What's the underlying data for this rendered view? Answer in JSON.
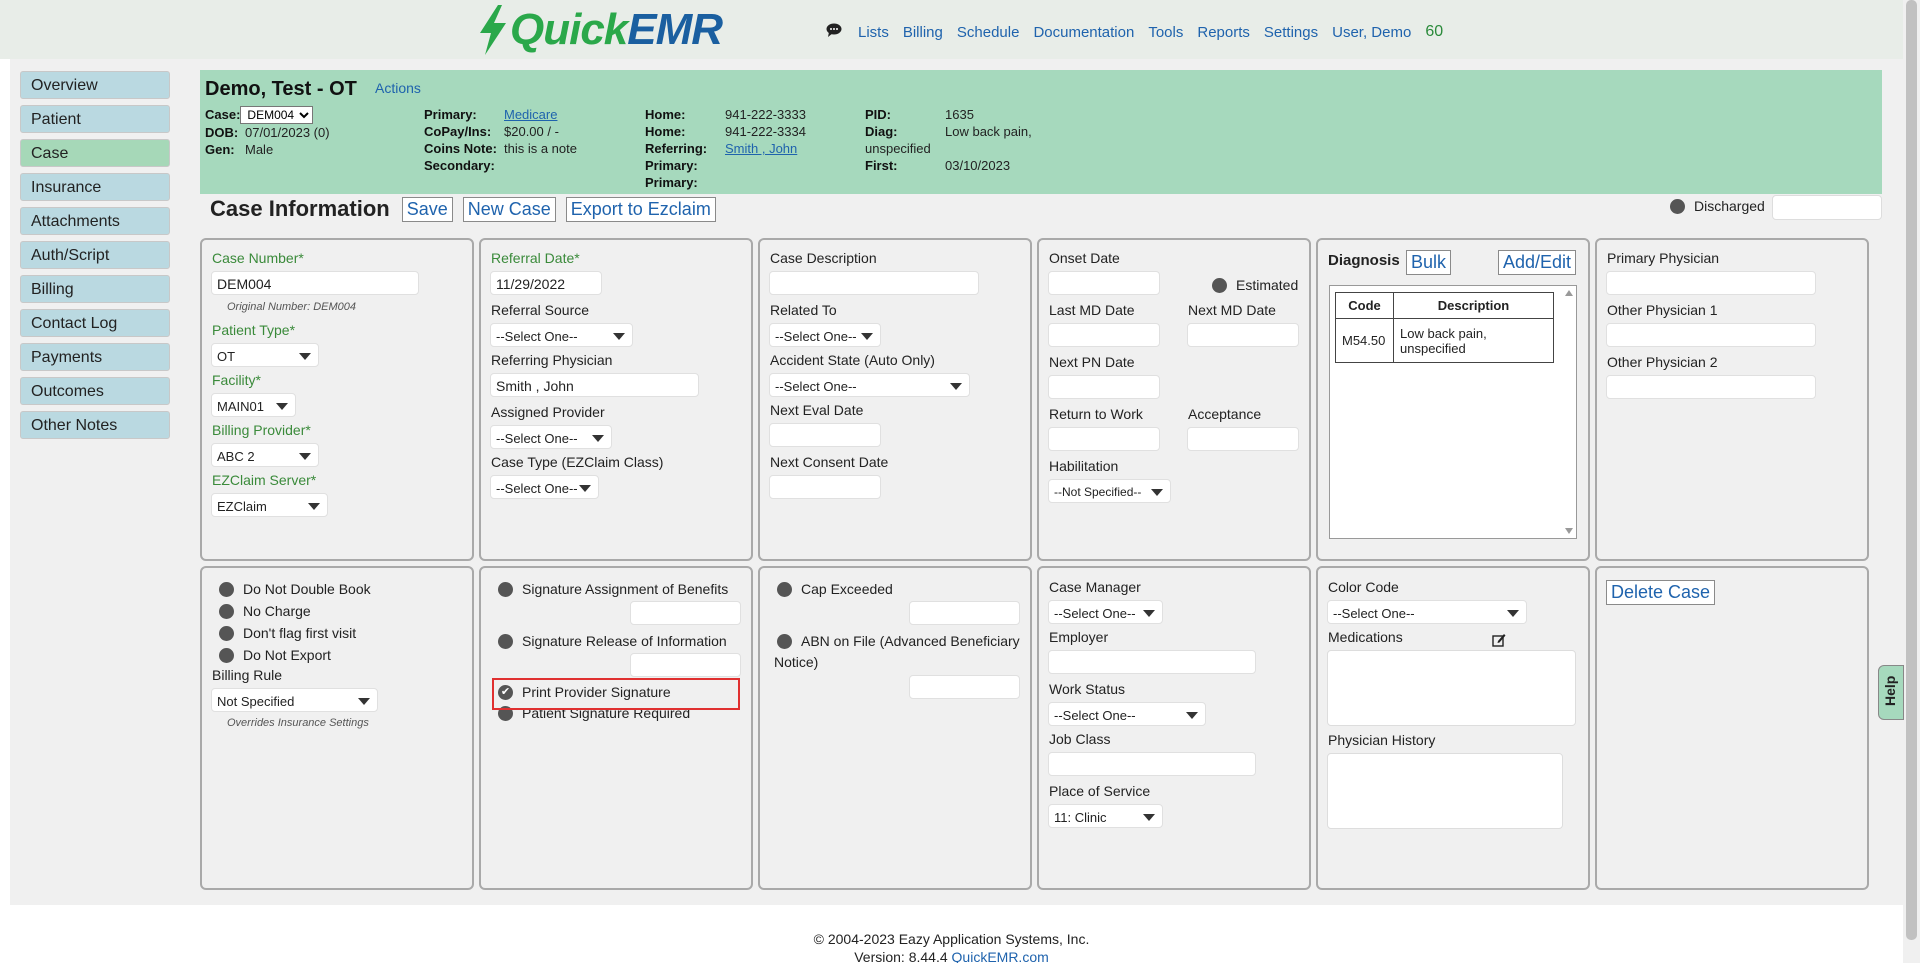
{
  "app": {
    "logo_quick": "Quick",
    "logo_emr": "EMR"
  },
  "topnav": {
    "items": [
      "Lists",
      "Billing",
      "Schedule",
      "Documentation",
      "Tools",
      "Reports",
      "Settings",
      "User, Demo"
    ],
    "count": "60"
  },
  "sidebar": {
    "items": [
      "Overview",
      "Patient",
      "Case",
      "Insurance",
      "Attachments",
      "Auth/Script",
      "Billing",
      "Contact Log",
      "Payments",
      "Outcomes",
      "Other Notes"
    ],
    "active": "Case"
  },
  "header": {
    "patient_name": "Demo, Test - OT",
    "actions_label": "Actions",
    "case_label": "Case:",
    "case_value": "DEM004",
    "dob_label": "DOB:",
    "dob_value": "07/01/2023 (0)",
    "gen_label": "Gen:",
    "gen_value": "Male",
    "primary_label": "Primary:",
    "primary_value": "Medicare",
    "copay_label": "CoPay/Ins:",
    "copay_value": "$20.00 / -",
    "coins_label": "Coins Note:",
    "coins_value": "this is a note",
    "secondary_label": "Secondary:",
    "home1_label": "Home:",
    "home1_value": "941-222-3333",
    "home2_label": "Home:",
    "home2_value": "941-222-3334",
    "referring_label": "Referring:",
    "referring_value": "Smith , John",
    "primary2_label": "Primary:",
    "primary3_label": "Primary:",
    "pid_label": "PID:",
    "pid_value": "1635",
    "diag_label": "Diag:",
    "diag_value_1": "Low back pain,",
    "diag_value_2": "unspecified",
    "first_label": "First:",
    "first_value": "03/10/2023"
  },
  "titlebar": {
    "title": "Case Information",
    "save": "Save",
    "new_case": "New Case",
    "export": "Export to Ezclaim",
    "discharged": "Discharged"
  },
  "panel1": {
    "case_number_label": "Case Number*",
    "case_number_value": "DEM004",
    "original_number": "Original Number: DEM004",
    "patient_type_label": "Patient Type*",
    "patient_type_value": "OT",
    "facility_label": "Facility*",
    "facility_value": "MAIN01",
    "billing_provider_label": "Billing Provider*",
    "billing_provider_value": "ABC 2",
    "ezclaim_server_label": "EZClaim Server*",
    "ezclaim_server_value": "EZClaim"
  },
  "panel2": {
    "referral_date_label": "Referral Date*",
    "referral_date_value": "11/29/2022",
    "referral_source_label": "Referral Source",
    "referral_source_value": "--Select One--",
    "referring_physician_label": "Referring Physician",
    "referring_physician_value": "Smith , John",
    "assigned_provider_label": "Assigned Provider",
    "assigned_provider_value": "--Select One--",
    "case_type_label": "Case Type (EZClaim Class)",
    "case_type_value": "--Select One--"
  },
  "panel3": {
    "case_description_label": "Case Description",
    "related_to_label": "Related To",
    "related_to_value": "--Select One--",
    "accident_state_label": "Accident State (Auto Only)",
    "accident_state_value": "--Select One--",
    "next_eval_label": "Next Eval Date",
    "next_consent_label": "Next Consent Date"
  },
  "panel4": {
    "onset_label": "Onset Date",
    "estimated_label": "Estimated",
    "last_md_label": "Last MD Date",
    "next_md_label": "Next MD Date",
    "next_pn_label": "Next PN Date",
    "return_work_label": "Return to Work",
    "acceptance_label": "Acceptance",
    "habilitation_label": "Habilitation",
    "habilitation_value": "--Not Specified--"
  },
  "panel5": {
    "diagnosis_label": "Diagnosis",
    "bulk": "Bulk",
    "add_edit": "Add/Edit",
    "col_code": "Code",
    "col_description": "Description",
    "rows": [
      {
        "code": "M54.50",
        "desc_1": "Low back pain,",
        "desc_2": "unspecified"
      }
    ]
  },
  "panel6": {
    "primary_physician_label": "Primary Physician",
    "other_physician_1_label": "Other Physician 1",
    "other_physician_2_label": "Other Physician 2"
  },
  "panel7": {
    "do_not_double_book": "Do Not Double Book",
    "no_charge": "No Charge",
    "dont_flag_first_visit": "Don't flag first visit",
    "do_not_export": "Do Not Export",
    "billing_rule_label": "Billing Rule",
    "billing_rule_value": "Not Specified",
    "overrides_note": "Overrides Insurance Settings"
  },
  "panel8": {
    "sig_assignment": "Signature Assignment of Benefits",
    "sig_release": "Signature Release of Information",
    "print_provider_sig": "Print Provider Signature",
    "patient_sig_required": "Patient Signature Required"
  },
  "panel9": {
    "cap_exceeded": "Cap Exceeded",
    "abn_on_file_1": "ABN on File (Advanced Beneficiary",
    "abn_on_file_2": "Notice)"
  },
  "panel10": {
    "case_manager_label": "Case Manager",
    "case_manager_value": "--Select One--",
    "employer_label": "Employer",
    "work_status_label": "Work Status",
    "work_status_value": "--Select One--",
    "job_class_label": "Job Class",
    "place_of_service_label": "Place of Service",
    "place_of_service_value": "11: Clinic"
  },
  "panel11": {
    "color_code_label": "Color Code",
    "color_code_value": "--Select One--",
    "medications_label": "Medications",
    "physician_history_label": "Physician History"
  },
  "panel12": {
    "delete_case": "Delete Case"
  },
  "help": "Help",
  "footer": {
    "copyright": "© 2004-2023 Eazy Application Systems, Inc.",
    "version_label": "Version: 8.44.4",
    "site_link": "QuickEMR.com"
  },
  "colors": {
    "header_green": "#a6d9bd",
    "nav_blue": "#bad9e1",
    "link_blue": "#1f63ad",
    "required_green": "#3a8a3a",
    "highlight_red": "#e03030"
  }
}
